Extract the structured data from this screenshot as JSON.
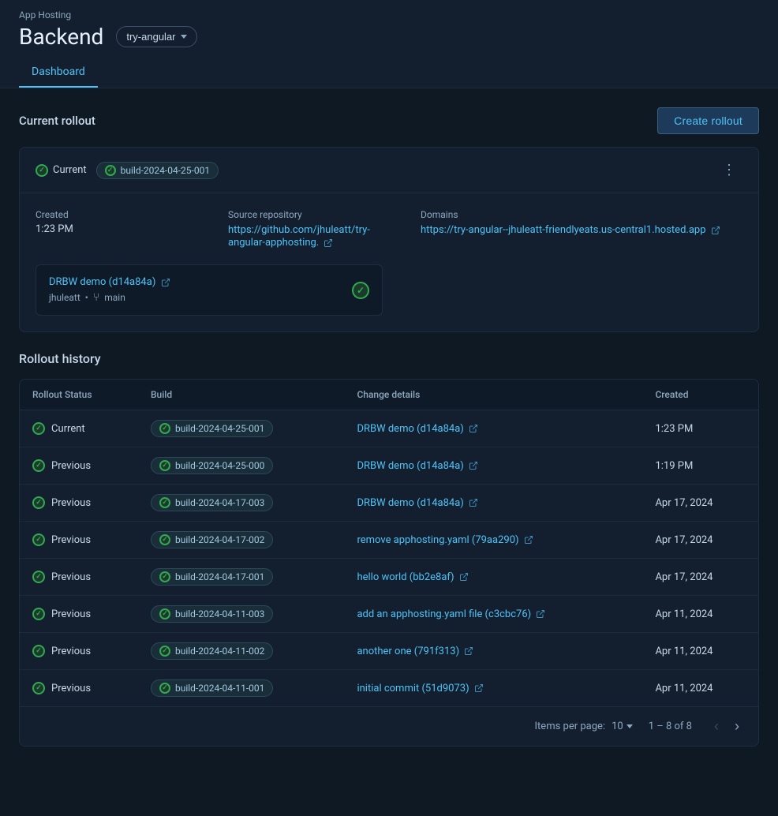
{
  "appHostingLabel": "App Hosting",
  "pageTitle": "Backend",
  "backendSelector": {
    "value": "try-angular",
    "options": [
      "try-angular"
    ]
  },
  "tabs": [
    {
      "id": "dashboard",
      "label": "Dashboard",
      "active": true
    }
  ],
  "currentRollout": {
    "sectionTitle": "Current rollout",
    "createButton": "Create rollout",
    "status": "Current",
    "buildBadge": "build-2024-04-25-001",
    "created": {
      "label": "Created",
      "value": "1:23 PM"
    },
    "sourceRepo": {
      "label": "Source repository",
      "url": "https://github.com/jhuleatt/try-angular-apphosting",
      "displayText": "https://github.com/jhuleatt/try-angular-apphosting."
    },
    "domains": {
      "label": "Domains",
      "url": "https://try-angular--jhuleatt-friendlyeats.us-central1.hosted.app",
      "displayText": "https://try-angular--jhuleatt-friendlyeats.us-central1.hosted.app"
    },
    "commit": {
      "linkText": "DRBW demo (d14a84a)",
      "author": "jhuleatt",
      "branch": "main"
    },
    "moreButton": "⋮"
  },
  "rolloutHistory": {
    "sectionTitle": "Rollout history",
    "columns": {
      "rolloutStatus": "Rollout Status",
      "build": "Build",
      "changeDetails": "Change details",
      "created": "Created"
    },
    "rows": [
      {
        "status": "Current",
        "build": "build-2024-04-25-001",
        "changeDetails": "DRBW demo (d14a84a)",
        "created": "1:23 PM"
      },
      {
        "status": "Previous",
        "build": "build-2024-04-25-000",
        "changeDetails": "DRBW demo (d14a84a)",
        "created": "1:19 PM"
      },
      {
        "status": "Previous",
        "build": "build-2024-04-17-003",
        "changeDetails": "DRBW demo (d14a84a)",
        "created": "Apr 17, 2024"
      },
      {
        "status": "Previous",
        "build": "build-2024-04-17-002",
        "changeDetails": "remove apphosting.yaml (79aa290)",
        "created": "Apr 17, 2024"
      },
      {
        "status": "Previous",
        "build": "build-2024-04-17-001",
        "changeDetails": "hello world (bb2e8af)",
        "created": "Apr 17, 2024"
      },
      {
        "status": "Previous",
        "build": "build-2024-04-11-003",
        "changeDetails": "add an apphosting.yaml file (c3cbc76)",
        "created": "Apr 11, 2024"
      },
      {
        "status": "Previous",
        "build": "build-2024-04-11-002",
        "changeDetails": "another one (791f313)",
        "created": "Apr 11, 2024"
      },
      {
        "status": "Previous",
        "build": "build-2024-04-11-001",
        "changeDetails": "initial commit (51d9073)",
        "created": "Apr 11, 2024"
      }
    ],
    "pagination": {
      "itemsPerPageLabel": "Items per page:",
      "itemsPerPage": "10",
      "pageInfo": "1 – 8 of 8"
    }
  }
}
